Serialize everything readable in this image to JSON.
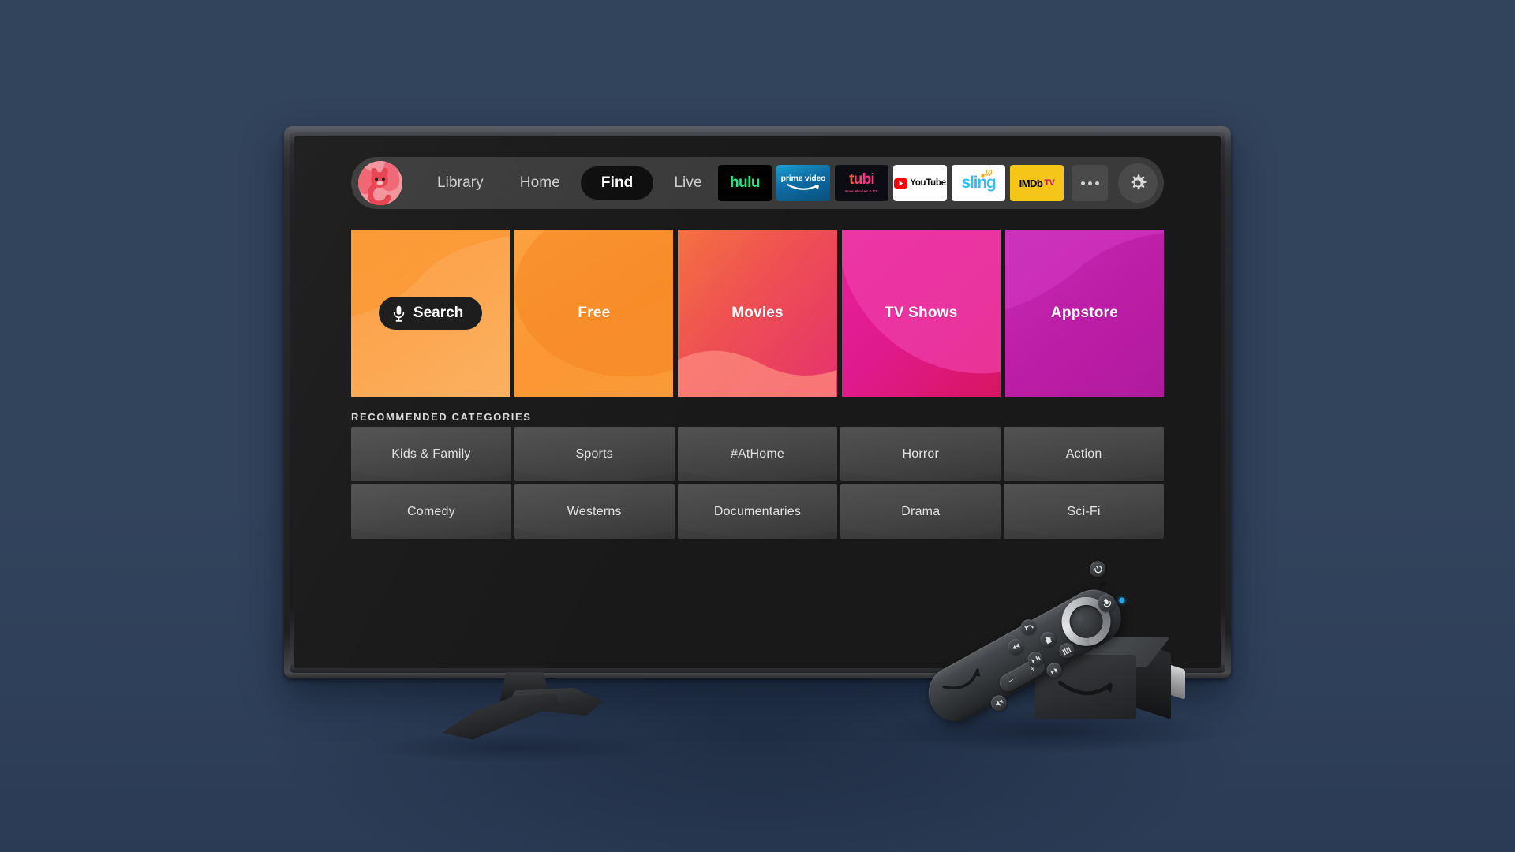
{
  "device": {
    "tv_label": "smart-tv",
    "background_color": "#32435c",
    "screen_background": "#191919"
  },
  "navbar": {
    "avatar_alt": "profile-avatar",
    "links": [
      {
        "label": "Library",
        "active": false
      },
      {
        "label": "Home",
        "active": false
      },
      {
        "label": "Find",
        "active": true
      },
      {
        "label": "Live",
        "active": false
      }
    ],
    "apps": [
      {
        "name": "hulu",
        "label": "hulu",
        "bg": "#000000",
        "fg": "#1ce783"
      },
      {
        "name": "prime-video",
        "label": "prime video",
        "bg": "#0e6ca3",
        "fg": "#ffffff"
      },
      {
        "name": "tubi",
        "label": "tubi",
        "sub": "Free Movies & TV",
        "bg": "#0c0c14",
        "fg": "#ff4f78"
      },
      {
        "name": "youtube",
        "label": "YouTube",
        "bg": "#ffffff",
        "fg": "#0b0b0b"
      },
      {
        "name": "sling",
        "label": "sling",
        "bg": "#ffffff",
        "fg": "#37bdf0"
      },
      {
        "name": "imdb-tv",
        "label": "IMDb",
        "sub": "TV",
        "bg": "#f5c518",
        "fg": "#000000"
      }
    ],
    "more_label": "more-options",
    "settings_label": "settings"
  },
  "big_tiles": [
    {
      "name": "search",
      "label": "Search",
      "kind": "search-pill",
      "color": "#fba03c"
    },
    {
      "name": "free",
      "label": "Free",
      "kind": "label",
      "color": "#fb9632"
    },
    {
      "name": "movies",
      "label": "Movies",
      "kind": "label",
      "color": "#ef5350"
    },
    {
      "name": "tv-shows",
      "label": "TV Shows",
      "kind": "label",
      "color": "#e01a8f"
    },
    {
      "name": "appstore",
      "label": "Appstore",
      "kind": "label",
      "color": "#bd1fa8"
    }
  ],
  "recommended": {
    "heading": "RECOMMENDED CATEGORIES",
    "rows": [
      [
        {
          "label": "Kids & Family"
        },
        {
          "label": "Sports"
        },
        {
          "label": "#AtHome"
        },
        {
          "label": "Horror"
        },
        {
          "label": "Action"
        }
      ],
      [
        {
          "label": "Comedy"
        },
        {
          "label": "Westerns"
        },
        {
          "label": "Documentaries"
        },
        {
          "label": "Drama"
        },
        {
          "label": "Sci-Fi"
        }
      ]
    ]
  },
  "hardware": {
    "remote_name": "fire-tv-remote",
    "stick_name": "fire-tv-stick",
    "stand_name": "tv-stand",
    "remote_buttons": [
      {
        "name": "power",
        "glyph": "⏻"
      },
      {
        "name": "voice-mic",
        "glyph": "🎙"
      },
      {
        "name": "navigation-dpad",
        "glyph": ""
      },
      {
        "name": "back",
        "glyph": "↶"
      },
      {
        "name": "home",
        "glyph": "⌂"
      },
      {
        "name": "menu",
        "glyph": "☰"
      },
      {
        "name": "rewind",
        "glyph": "◂◂"
      },
      {
        "name": "play-pause",
        "glyph": "▸‖"
      },
      {
        "name": "fast-forward",
        "glyph": "▸▸"
      },
      {
        "name": "volume-up",
        "glyph": "+"
      },
      {
        "name": "volume-down",
        "glyph": "−"
      },
      {
        "name": "mute",
        "glyph": "🔇"
      }
    ]
  }
}
